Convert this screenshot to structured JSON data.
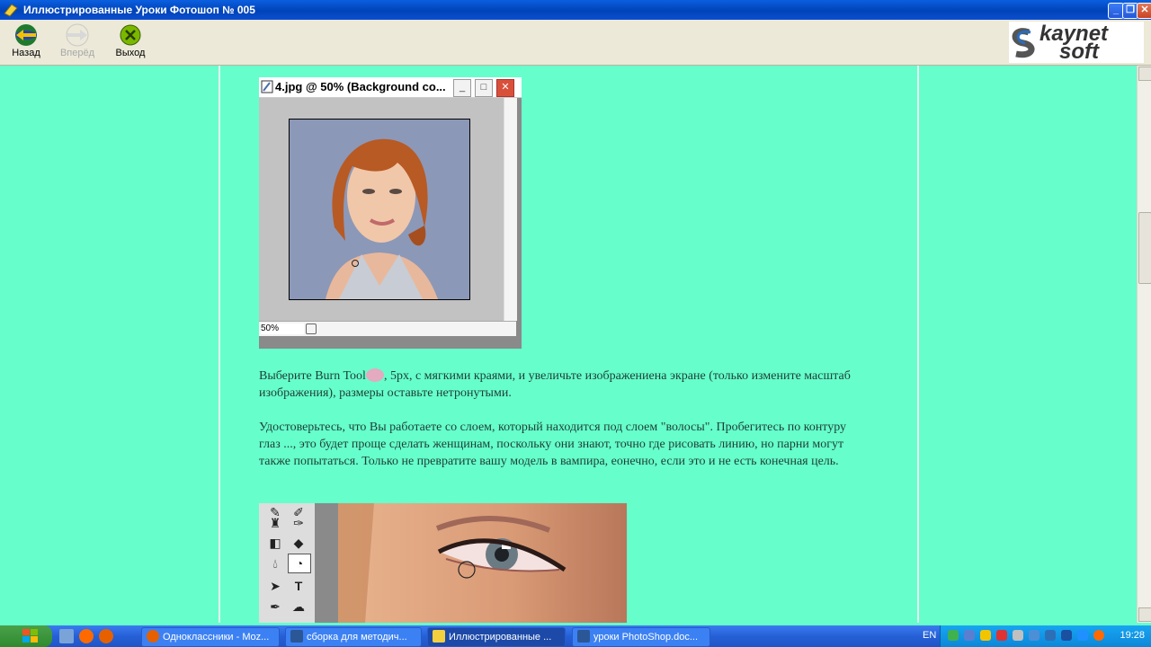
{
  "window": {
    "title": "Иллюстрированные Уроки Фотошоп № 005",
    "minimize_label": "_",
    "maximize_label": "❐",
    "close_label": "✕"
  },
  "toolbar": {
    "back_label": "Назад",
    "forward_label": "Вперёд",
    "exit_label": "Выход"
  },
  "logo": {
    "line1": "kaynet",
    "line2": "soft",
    "accent_color": "#2a6cbf"
  },
  "psdoc": {
    "title": "4.jpg @ 50% (Background co...",
    "zoom": "50%"
  },
  "content": {
    "para1_pre": "Выберите Burn Tool",
    "para1_post": ", 5px, с мягкими краями, и увеличьте изображениена экране (только измените масштаб изображения), размеры оставьте нетронутыми.",
    "para2": "Удостоверьтесь, что Вы работаете со слоем, который находится под слоем \"волосы\". Пробегитесь по контуру глаз ..., это будет проще сделать женщинам, поскольку они знают, точно где рисовать линию, но парни могут также попытаться. Только не превратите вашу модель в вампира, еонечно, если это и не есть конечная цель.",
    "bg_color": "#66ffcc"
  },
  "tools": {
    "type_tool": "T"
  },
  "taskbar": {
    "tasks": [
      {
        "label": "Одноклассники - Moz..."
      },
      {
        "label": "сборка для методич..."
      },
      {
        "label": "Иллюстрированные ..."
      },
      {
        "label": "уроки PhotoShop.doc..."
      }
    ],
    "lang": "EN",
    "clock": "19:28"
  }
}
